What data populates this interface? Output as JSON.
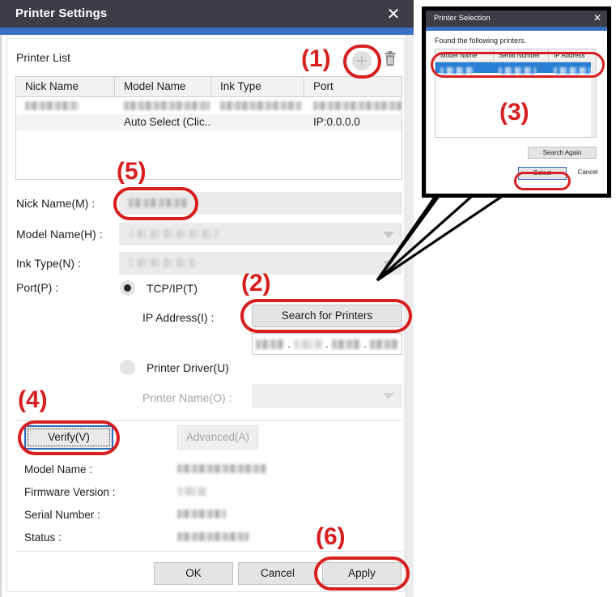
{
  "main_dialog": {
    "title": "Printer Settings",
    "close_icon": "close-icon",
    "printer_list": {
      "label": "Printer List",
      "add_icon": "add-circle-icon",
      "delete_icon": "trash-icon",
      "columns": [
        "Nick Name",
        "Model Name",
        "Ink Type",
        "Port"
      ],
      "rows": [
        {
          "nick_name": "",
          "model_name": "",
          "ink_type": "",
          "port": "",
          "redacted": true
        },
        {
          "nick_name": "",
          "model_name": "Auto Select (Clic...",
          "ink_type": "",
          "port": "IP:0.0.0.0",
          "redacted": false
        }
      ]
    },
    "fields": {
      "nick_name_label": "Nick Name(M) :",
      "nick_name_value": "",
      "model_name_label": "Model Name(H) :",
      "model_name_value": "",
      "ink_type_label": "Ink Type(N) :",
      "ink_type_value": "",
      "port_label": "Port(P) :",
      "tcpip_label": "TCP/IP(T)",
      "tcpip_selected": true,
      "ip_address_label": "IP Address(I) :",
      "search_for_printers_label": "Search for Printers",
      "ip_octets": [
        "",
        "",
        "",
        ""
      ],
      "printer_driver_label": "Printer Driver(U)",
      "printer_driver_selected": false,
      "printer_name_label": "Printer Name(O) :",
      "printer_name_value": ""
    },
    "actions": {
      "verify_label": "Verify(V)",
      "advanced_label": "Advanced(A)",
      "advanced_disabled": true
    },
    "info": {
      "model_name_label": "Model Name :",
      "model_name_value": "",
      "firmware_version_label": "Firmware Version :",
      "firmware_version_value": "",
      "serial_number_label": "Serial Number :",
      "serial_number_value": "",
      "status_label": "Status :",
      "status_value": ""
    },
    "footer": {
      "ok_label": "OK",
      "cancel_label": "Cancel",
      "apply_label": "Apply"
    }
  },
  "inset_dialog": {
    "title": "Printer Selection",
    "close_icon": "close-icon",
    "found_text": "Found the following printers.",
    "columns": [
      "Model Name",
      "Serial Number",
      "IP Address"
    ],
    "rows": [
      {
        "model_name": "",
        "serial_number": "",
        "ip_address": "",
        "selected": true
      }
    ],
    "search_again_label": "Search Again",
    "select_label": "Select",
    "cancel_label": "Cancel"
  },
  "annotations": {
    "accent_color": "#d81f1f",
    "callouts": [
      {
        "id": "1",
        "label": "(1)",
        "target": "add-printer-button"
      },
      {
        "id": "2",
        "label": "(2)",
        "target": "search-for-printers-button"
      },
      {
        "id": "3",
        "label": "(3)",
        "target": "printer-selection-list"
      },
      {
        "id": "4",
        "label": "(4)",
        "target": "verify-button"
      },
      {
        "id": "5",
        "label": "(5)",
        "target": "nick-name-input"
      },
      {
        "id": "6",
        "label": "(6)",
        "target": "apply-button"
      }
    ]
  },
  "theme": {
    "titlebar_color": "#3d3d46",
    "accent_blue": "#3a6fc4",
    "selection_blue": "#2a7fd4"
  }
}
